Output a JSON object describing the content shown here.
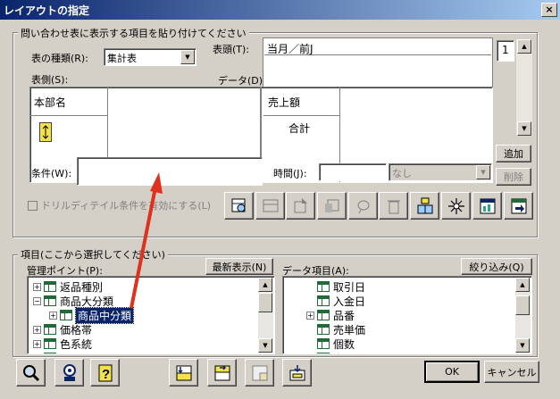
{
  "window": {
    "title": "レイアウトの指定",
    "close_label": "×"
  },
  "layout_group": {
    "label": "問い合わせ表に表示する項目を貼り付けてください"
  },
  "table_type": {
    "label": "表の種類(R):",
    "value": "集計表"
  },
  "hyoutou": {
    "label": "表頭(T):",
    "value": "当月／前J"
  },
  "hyousoku": {
    "label": "表側(S):",
    "cell": "本部名"
  },
  "data": {
    "label": "データ(D):",
    "header": "売上額",
    "sub": "合計"
  },
  "spin": {
    "value": "1"
  },
  "add_button": "追加",
  "delete_button": "削除",
  "condition": {
    "label": "条件(W):",
    "value": ""
  },
  "time": {
    "label": "時間(J):",
    "value": "",
    "select": "なし"
  },
  "drill_checkbox": {
    "label": "ドリルディテイル条件を有効にする(L)",
    "checked": false
  },
  "items_group": {
    "label": "項目(ここから選択してください)"
  },
  "mgmt_point": {
    "label": "管理ポイント(P):",
    "refresh_button": "最新表示(N)",
    "tree": [
      {
        "text": "返品種別",
        "expander": "+",
        "indent": 0
      },
      {
        "text": "商品大分類",
        "expander": "−",
        "indent": 0
      },
      {
        "text": "商品中分類",
        "expander": "+",
        "indent": 1,
        "selected": true
      },
      {
        "text": "価格帯",
        "expander": "+",
        "indent": 0
      },
      {
        "text": "色系統",
        "expander": "+",
        "indent": 0
      },
      {
        "text": "返品",
        "expander": "+",
        "indent": 0
      }
    ]
  },
  "data_items": {
    "label": "データ項目(A):",
    "filter_button": "絞り込み(Q)",
    "tree": [
      {
        "text": "取引日",
        "expander": ""
      },
      {
        "text": "入金日",
        "expander": ""
      },
      {
        "text": "品番",
        "expander": "+"
      },
      {
        "text": "売単価",
        "expander": ""
      },
      {
        "text": "個数",
        "expander": ""
      },
      {
        "text": "売上額",
        "expander": ""
      }
    ]
  },
  "ok_button": "OK",
  "cancel_button": "キャンセル",
  "colors": {
    "title_start": "#0a246a",
    "title_end": "#a6caf0",
    "arrow": "#e0301e",
    "face": "#d4d0c8"
  }
}
